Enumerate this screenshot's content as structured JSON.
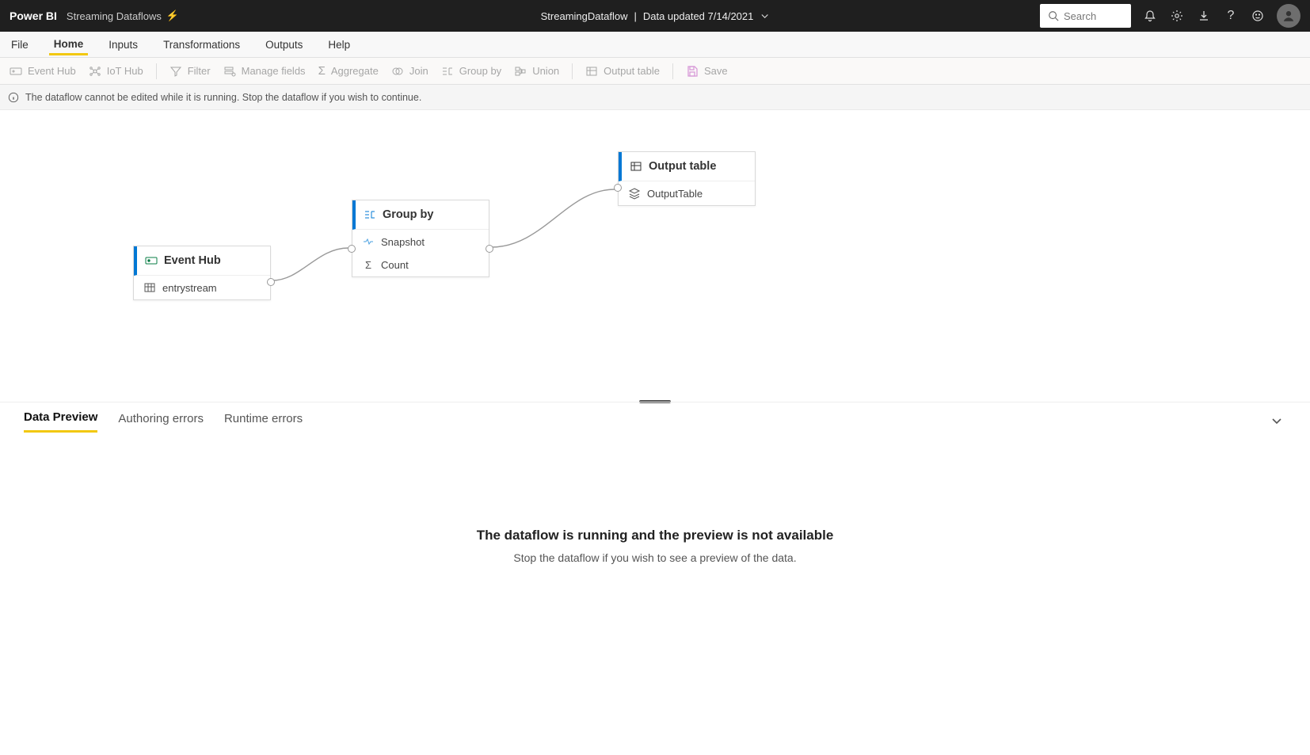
{
  "header": {
    "brand": "Power BI",
    "subtitle": "Streaming Dataflows",
    "center_left": "StreamingDataflow",
    "center_right": "Data updated 7/14/2021",
    "search_placeholder": "Search"
  },
  "menubar": {
    "items": [
      "File",
      "Home",
      "Inputs",
      "Transformations",
      "Outputs",
      "Help"
    ],
    "active": 1
  },
  "toolbar": {
    "event_hub": "Event Hub",
    "iot_hub": "IoT Hub",
    "filter": "Filter",
    "manage_fields": "Manage fields",
    "aggregate": "Aggregate",
    "join": "Join",
    "group_by": "Group by",
    "union": "Union",
    "output_table": "Output table",
    "save": "Save"
  },
  "info_message": "The dataflow cannot be edited while it is running. Stop the dataflow if you wish to continue.",
  "nodes": {
    "event_hub": {
      "title": "Event Hub",
      "row": "entrystream"
    },
    "group_by": {
      "title": "Group by",
      "row1": "Snapshot",
      "row2": "Count"
    },
    "output": {
      "title": "Output table",
      "row": "OutputTable"
    }
  },
  "tabs": {
    "items": [
      "Data Preview",
      "Authoring errors",
      "Runtime errors"
    ],
    "active": 0
  },
  "preview": {
    "title": "The dataflow is running and the preview is not available",
    "subtitle": "Stop the dataflow if you wish to see a preview of the data."
  }
}
